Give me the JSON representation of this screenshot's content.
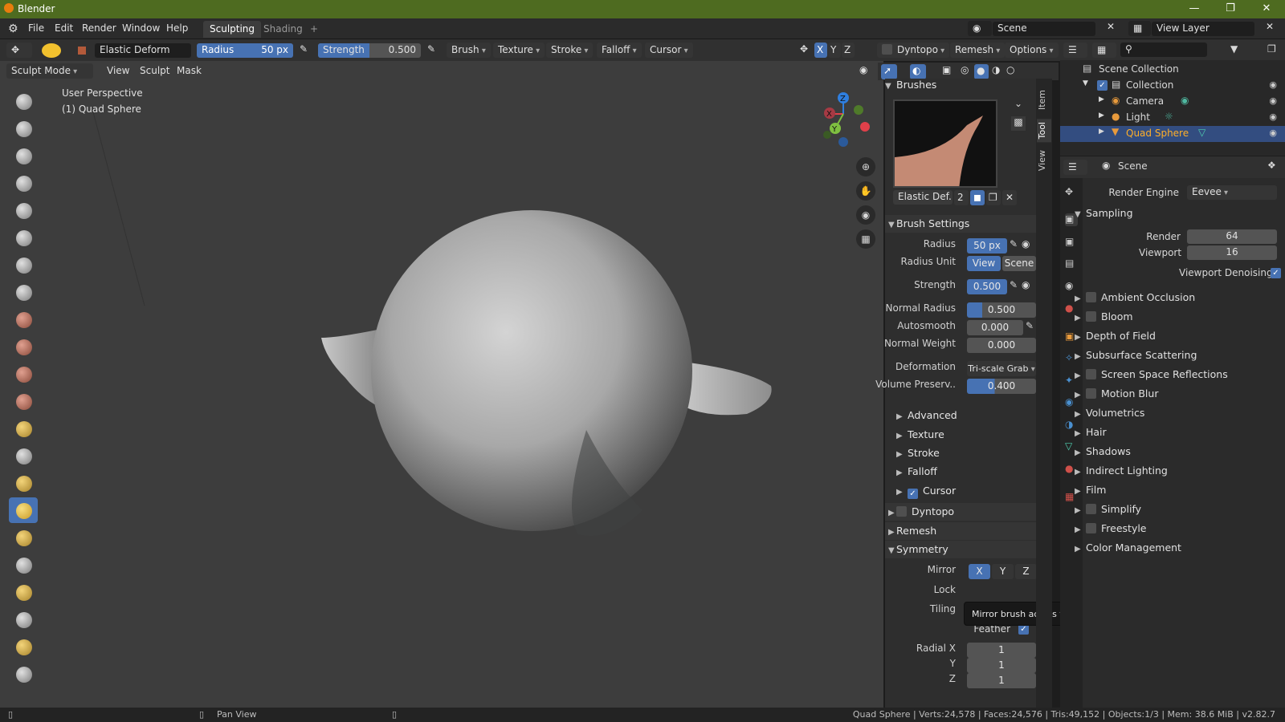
{
  "app": {
    "title": "Blender"
  },
  "menu": [
    "File",
    "Edit",
    "Render",
    "Window",
    "Help"
  ],
  "workspaces": {
    "active": "Sculpting",
    "inactive": "Shading",
    "add": "+"
  },
  "scene_selector": "Scene",
  "view_layer": "View Layer",
  "header": {
    "brush_name": "Elastic Deform",
    "radius_label": "Radius",
    "radius_value": "50 px",
    "strength_label": "Strength",
    "strength_value": "0.500",
    "menus": [
      "Brush",
      "Texture",
      "Stroke",
      "Falloff",
      "Cursor"
    ],
    "axes": [
      "X",
      "Y",
      "Z"
    ],
    "dyntopo": "Dyntopo",
    "remesh": "Remesh",
    "options": "Options"
  },
  "viewport": {
    "mode": "Sculpt Mode",
    "menus": [
      "View",
      "Sculpt",
      "Mask"
    ],
    "overlay_line1": "User Perspective",
    "overlay_line2": "(1) Quad Sphere",
    "gizmo": {
      "x": "X",
      "y": "Y",
      "z": "Z"
    }
  },
  "npanel": {
    "brushes_header": "Brushes",
    "brush_preview_name": "Elastic Def..",
    "brush_users": "2",
    "brush_settings_header": "Brush Settings",
    "radius": {
      "label": "Radius",
      "value": "50 px"
    },
    "radius_unit": {
      "label": "Radius Unit",
      "view": "View",
      "scene": "Scene"
    },
    "strength": {
      "label": "Strength",
      "value": "0.500"
    },
    "normal_radius": {
      "label": "Normal Radius",
      "value": "0.500"
    },
    "autosmooth": {
      "label": "Autosmooth",
      "value": "0.000"
    },
    "normal_weight": {
      "label": "Normal Weight",
      "value": "0.000"
    },
    "deformation": {
      "label": "Deformation",
      "value": "Tri-scale Grab"
    },
    "volume_preserve": {
      "label": "Volume Preserv..",
      "value": "0.400"
    },
    "subpanels": [
      "Advanced",
      "Texture",
      "Stroke",
      "Falloff",
      "Cursor"
    ],
    "dyntopo": "Dyntopo",
    "remesh": "Remesh",
    "symmetry": "Symmetry",
    "mirror": {
      "label": "Mirror",
      "x": "X",
      "y": "Y",
      "z": "Z"
    },
    "lock": {
      "label": "Lock"
    },
    "tiling": {
      "label": "Tiling"
    },
    "feather": {
      "label": "Feather"
    },
    "radial_x": {
      "label": "Radial X",
      "value": "1"
    },
    "radial_y": {
      "label": "Y",
      "value": "1"
    },
    "radial_z": {
      "label": "Z",
      "value": "1"
    },
    "tooltip": "Mirror brush across the X axis."
  },
  "vtabs": [
    "Item",
    "Tool",
    "View"
  ],
  "outliner": {
    "root": "Scene Collection",
    "items": [
      {
        "name": "Collection"
      },
      {
        "name": "Camera"
      },
      {
        "name": "Light"
      },
      {
        "name": "Quad Sphere"
      }
    ]
  },
  "properties": {
    "context": "Scene",
    "render_engine": {
      "label": "Render Engine",
      "value": "Eevee"
    },
    "sampling": "Sampling",
    "render": {
      "label": "Render",
      "value": "64"
    },
    "viewport": {
      "label": "Viewport",
      "value": "16"
    },
    "viewport_denoising": "Viewport Denoising",
    "sections": [
      {
        "label": "Ambient Occlusion",
        "checkbox": true
      },
      {
        "label": "Bloom",
        "checkbox": true
      },
      {
        "label": "Depth of Field",
        "checkbox": false
      },
      {
        "label": "Subsurface Scattering",
        "checkbox": false
      },
      {
        "label": "Screen Space Reflections",
        "checkbox": true
      },
      {
        "label": "Motion Blur",
        "checkbox": true
      },
      {
        "label": "Volumetrics",
        "checkbox": false
      },
      {
        "label": "Hair",
        "checkbox": false
      },
      {
        "label": "Shadows",
        "checkbox": false
      },
      {
        "label": "Indirect Lighting",
        "checkbox": false
      },
      {
        "label": "Film",
        "checkbox": false
      },
      {
        "label": "Simplify",
        "checkbox": true
      },
      {
        "label": "Freestyle",
        "checkbox": true
      },
      {
        "label": "Color Management",
        "checkbox": false
      }
    ]
  },
  "status": {
    "pan": "Pan View",
    "stats": "Quad Sphere | Verts:24,578 | Faces:24,576 | Tris:49,152 | Objects:1/3 | Mem: 38.6 MiB | v2.82.7"
  },
  "colors": {
    "accent": "#4772b3",
    "titlebar": "#4e6b20",
    "selected_row": "#334d80"
  }
}
